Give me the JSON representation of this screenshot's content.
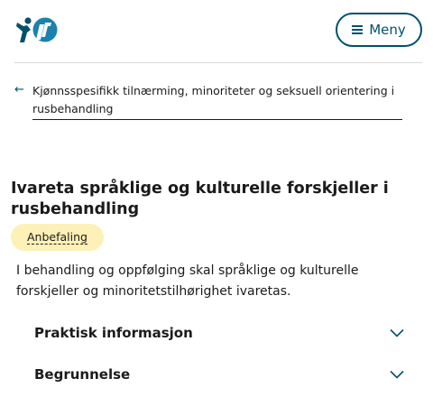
{
  "header": {
    "logo_icon": "helsedirektoratet-logo",
    "menu_label": "Meny",
    "menu_icon": "hamburger-icon",
    "brand_color": "#025169"
  },
  "breadcrumb": {
    "back_icon": "arrow-left-icon",
    "link_text": "Kjønnsspesifikk tilnærming, minoriteter og seksuell orientering i rusbehandling"
  },
  "content": {
    "title": "Ivareta språklige og kulturelle forskjeller i rusbehandling",
    "badge": "Anbefaling",
    "badge_color": "#fdf1b8",
    "body": "I behandling og oppfølging skal språklige og kulturelle forskjeller og minoritetstilhørighet ivaretas."
  },
  "accordions": [
    {
      "label": "Praktisk informasjon",
      "icon": "chevron-down-icon"
    },
    {
      "label": "Begrunnelse",
      "icon": "chevron-down-icon"
    }
  ]
}
